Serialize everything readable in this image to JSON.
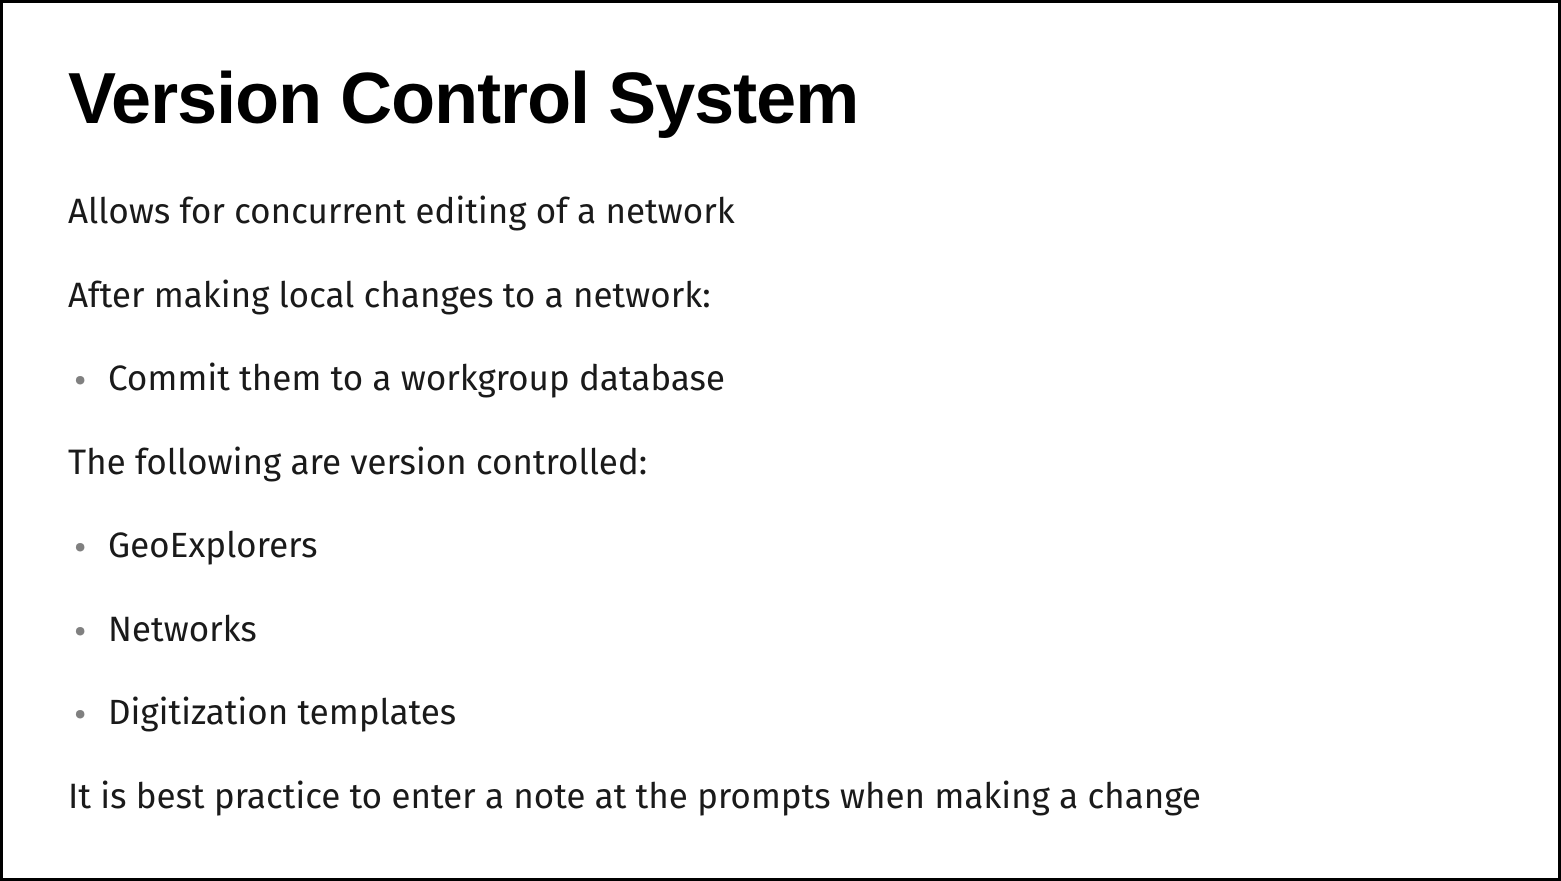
{
  "slide": {
    "title": "Version Control System",
    "paragraph1": "Allows for concurrent editing of a network",
    "paragraph2": "After making local changes to a network:",
    "list1": {
      "item1": "Commit them to a workgroup database"
    },
    "paragraph3": "The following are version controlled:",
    "list2": {
      "item1": "GeoExplorers",
      "item2": "Networks",
      "item3": "Digitization templates"
    },
    "paragraph4": "It is best practice to enter a note at the prompts when making a change"
  }
}
